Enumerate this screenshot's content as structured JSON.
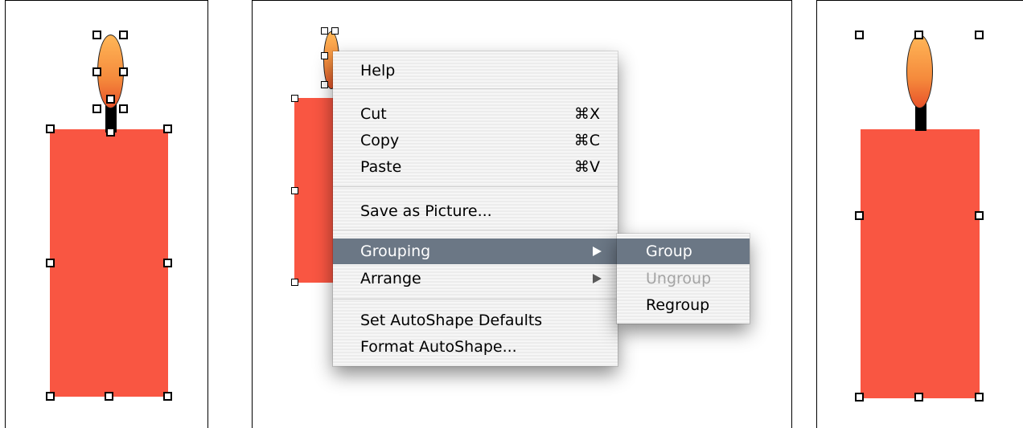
{
  "colors": {
    "shape_fill": "#f95642",
    "flame_top": "#ffb657",
    "flame_bottom": "#e8532a",
    "menu_highlight": "#6b7785",
    "menu_disabled": "#a4a4a4"
  },
  "context_menu": {
    "help": "Help",
    "cut": {
      "label": "Cut",
      "shortcut": "⌘X"
    },
    "copy": {
      "label": "Copy",
      "shortcut": "⌘C"
    },
    "paste": {
      "label": "Paste",
      "shortcut": "⌘V"
    },
    "save_as_picture": "Save as Picture...",
    "grouping": "Grouping",
    "arrange": "Arrange",
    "set_autoshape_defaults": "Set AutoShape Defaults",
    "format_autoshape": "Format AutoShape..."
  },
  "submenu": {
    "group": "Group",
    "ungroup": "Ungroup",
    "regroup": "Regroup"
  }
}
